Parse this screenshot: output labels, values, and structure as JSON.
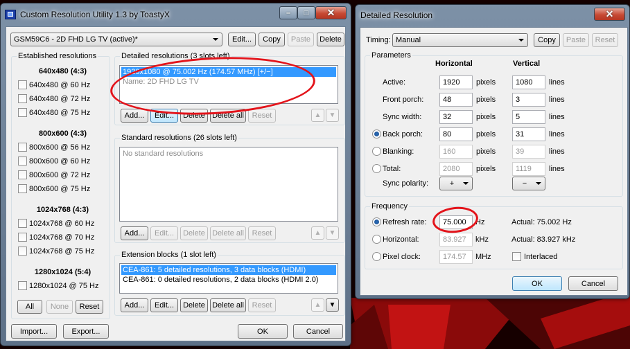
{
  "main_window": {
    "title": "Custom Resolution Utility 1.3 by ToastyX",
    "monitor_combo": "GSM59C6 - 2D FHD LG TV (active)*",
    "top_buttons": {
      "edit": "Edit...",
      "copy": "Copy",
      "paste": "Paste",
      "delete": "Delete"
    },
    "established": {
      "title": "Established resolutions",
      "groups": [
        {
          "heading": "640x480 (4:3)",
          "items": [
            "640x480 @ 60 Hz",
            "640x480 @ 72 Hz",
            "640x480 @ 75 Hz"
          ]
        },
        {
          "heading": "800x600 (4:3)",
          "items": [
            "800x600 @ 56 Hz",
            "800x600 @ 60 Hz",
            "800x600 @ 72 Hz",
            "800x600 @ 75 Hz"
          ]
        },
        {
          "heading": "1024x768 (4:3)",
          "items": [
            "1024x768 @ 60 Hz",
            "1024x768 @ 70 Hz",
            "1024x768 @ 75 Hz"
          ]
        },
        {
          "heading": "1280x1024 (5:4)",
          "items": [
            "1280x1024 @ 75 Hz"
          ]
        }
      ],
      "buttons": {
        "all": "All",
        "none": "None",
        "reset": "Reset"
      }
    },
    "detailed": {
      "title": "Detailed resolutions (3 slots left)",
      "items": [
        "1920x1080 @ 75.002 Hz (174.57 MHz) [+/−]",
        "Name: 2D FHD LG TV"
      ],
      "buttons": {
        "add": "Add...",
        "edit": "Edit...",
        "delete": "Delete",
        "delete_all": "Delete all",
        "reset": "Reset"
      }
    },
    "standard": {
      "title": "Standard resolutions (26 slots left)",
      "empty_text": "No standard resolutions",
      "buttons": {
        "add": "Add...",
        "edit": "Edit...",
        "delete": "Delete",
        "delete_all": "Delete all",
        "reset": "Reset"
      }
    },
    "extension": {
      "title": "Extension blocks (1 slot left)",
      "items": [
        "CEA-861: 5 detailed resolutions, 3 data blocks (HDMI)",
        "CEA-861: 0 detailed resolutions, 2 data blocks (HDMI 2.0)"
      ],
      "buttons": {
        "add": "Add...",
        "edit": "Edit...",
        "delete": "Delete",
        "delete_all": "Delete all",
        "reset": "Reset"
      }
    },
    "bottom_buttons": {
      "import": "Import...",
      "export": "Export...",
      "ok": "OK",
      "cancel": "Cancel"
    }
  },
  "detail_window": {
    "title": "Detailed Resolution",
    "timing_label": "Timing:",
    "timing_value": "Manual",
    "buttons": {
      "copy": "Copy",
      "paste": "Paste",
      "reset": "Reset",
      "ok": "OK",
      "cancel": "Cancel"
    },
    "parameters": {
      "title": "Parameters",
      "col_h": "Horizontal",
      "col_v": "Vertical",
      "rows": [
        {
          "label": "Active:",
          "h": "1920",
          "hu": "pixels",
          "v": "1080",
          "vu": "lines"
        },
        {
          "label": "Front porch:",
          "h": "48",
          "hu": "pixels",
          "v": "3",
          "vu": "lines"
        },
        {
          "label": "Sync width:",
          "h": "32",
          "hu": "pixels",
          "v": "5",
          "vu": "lines"
        },
        {
          "label": "Back porch:",
          "h": "80",
          "hu": "pixels",
          "v": "31",
          "vu": "lines"
        },
        {
          "label": "Blanking:",
          "h": "160",
          "hu": "pixels",
          "v": "39",
          "vu": "lines"
        },
        {
          "label": "Total:",
          "h": "2080",
          "hu": "pixels",
          "v": "1119",
          "vu": "lines"
        }
      ],
      "sync_polarity_label": "Sync polarity:",
      "sync_h": "+",
      "sync_v": "−"
    },
    "frequency": {
      "title": "Frequency",
      "refresh_label": "Refresh rate:",
      "refresh_value": "75.000",
      "refresh_unit": "Hz",
      "refresh_actual": "Actual: 75.002 Hz",
      "horizontal_label": "Horizontal:",
      "horizontal_value": "83.927",
      "horizontal_unit": "kHz",
      "horizontal_actual": "Actual: 83.927 kHz",
      "pixel_label": "Pixel clock:",
      "pixel_value": "174.57",
      "pixel_unit": "MHz",
      "interlaced_label": "Interlaced"
    }
  },
  "title_buttons": {
    "minimize": "–",
    "maximize": "□",
    "close": "✕"
  },
  "colors": {
    "highlight": "#e3141b",
    "selection": "#3399ff",
    "title_frame": "#6f849b"
  }
}
